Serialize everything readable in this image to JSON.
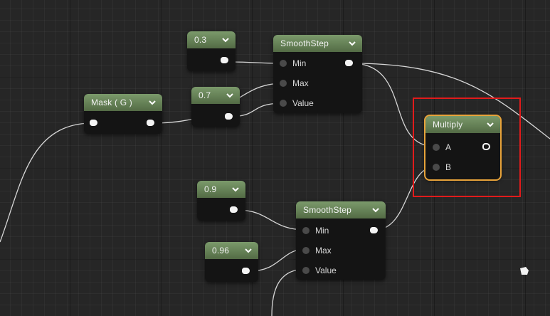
{
  "nodes": {
    "const_0_3": {
      "value": "0.3"
    },
    "const_0_7": {
      "value": "0.7"
    },
    "const_0_9": {
      "value": "0.9"
    },
    "const_0_96": {
      "value": "0.96"
    },
    "mask": {
      "title": "Mask ( G )"
    },
    "smoothstep_top": {
      "title": "SmoothStep",
      "inputs": [
        "Min",
        "Max",
        "Value"
      ]
    },
    "smoothstep_bottom": {
      "title": "SmoothStep",
      "inputs": [
        "Min",
        "Max",
        "Value"
      ]
    },
    "multiply": {
      "title": "Multiply",
      "inputs": [
        "A",
        "B"
      ]
    }
  },
  "colors": {
    "header_green": "#6c8a5c",
    "selection_orange": "#e8a33a",
    "annotation_red": "#e11b1b",
    "wire": "#d9d9d9"
  },
  "icons": [
    "chevron-down-icon",
    "output-pin-icon",
    "input-pin-icon",
    "cursor-icon"
  ]
}
